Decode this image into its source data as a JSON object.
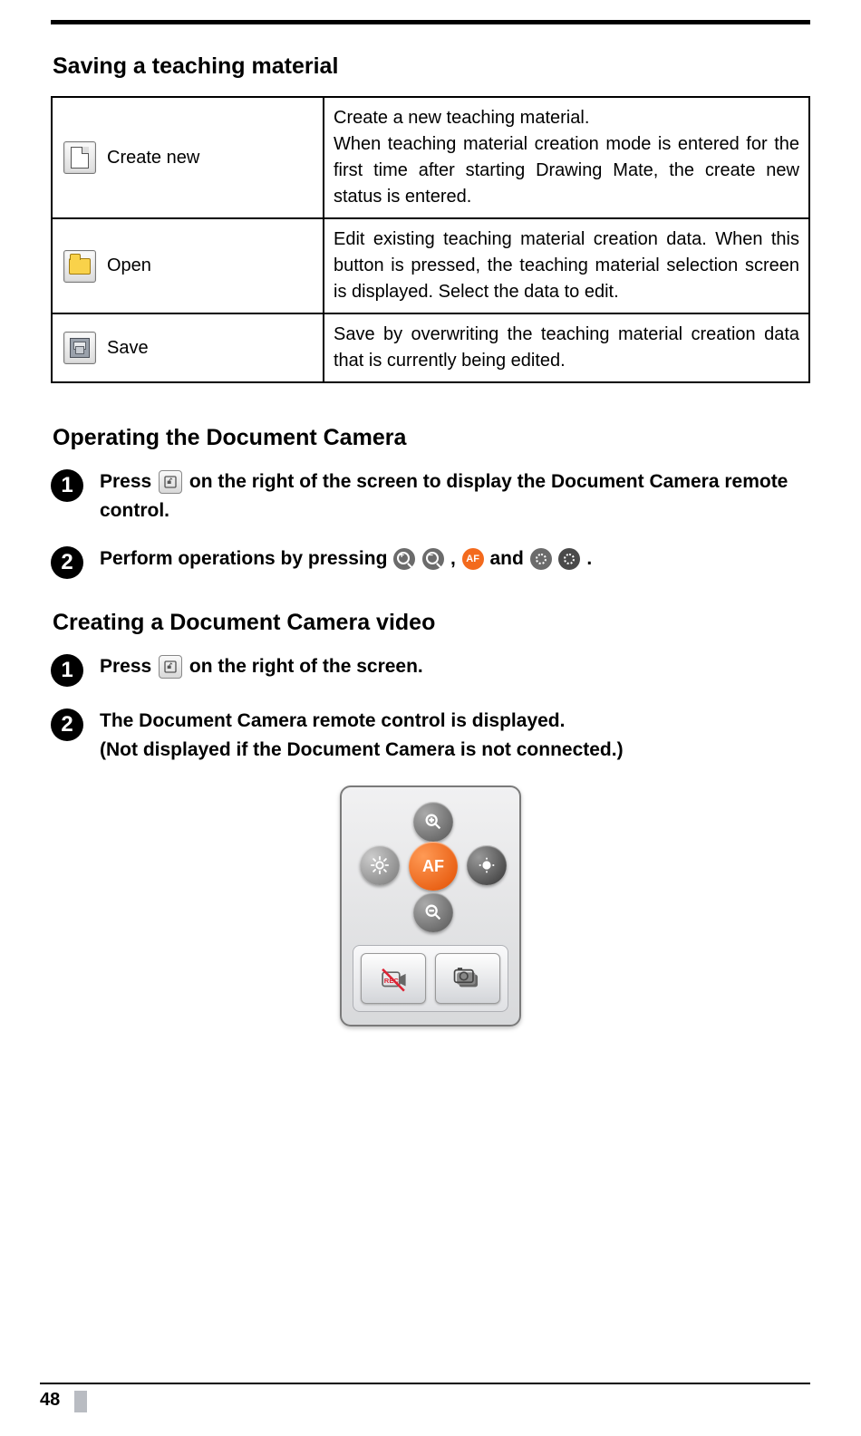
{
  "page_number": "48",
  "sections": {
    "saving": {
      "heading": "Saving a teaching material",
      "rows": [
        {
          "label": "Create new",
          "desc": "Create a new teaching material.\nWhen teaching material creation mode is entered for the first time after starting Drawing Mate, the create new status is entered."
        },
        {
          "label": "Open",
          "desc": "Edit existing teaching material creation data. When this button is pressed, the teaching material selection screen is displayed. Select the data to edit."
        },
        {
          "label": "Save",
          "desc": "Save by overwriting the teaching material creation data that is currently being edited."
        }
      ]
    },
    "operating": {
      "heading": "Operating the Document Camera",
      "step1_a": "Press ",
      "step1_b": " on the right of the screen to display the Document Camera remote control.",
      "step2_a": "Perform operations by pressing ",
      "step2_comma": ", ",
      "step2_and": " and ",
      "step2_end": "."
    },
    "creating": {
      "heading": "Creating a Document Camera video",
      "step1_a": "Press ",
      "step1_b": " on the right of the screen.",
      "step2": "The Document Camera remote control is displayed.\n(Not displayed if the Document Camera is not connected.)"
    }
  },
  "icons": {
    "af_label": "AF"
  }
}
